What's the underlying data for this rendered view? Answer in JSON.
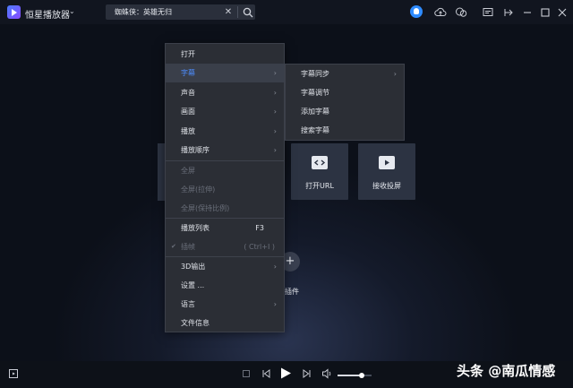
{
  "app": {
    "title": "恒星播放器",
    "title_chevron": "⌄"
  },
  "tab": {
    "label": "蜘蛛侠：英雄无归",
    "close": "✕"
  },
  "context_menu": {
    "items": [
      {
        "label": "打开",
        "state": "normal"
      },
      {
        "label": "字幕",
        "state": "active",
        "has_submenu": true
      },
      {
        "label": "声音",
        "state": "normal",
        "has_submenu": true
      },
      {
        "label": "画面",
        "state": "normal",
        "has_submenu": true
      },
      {
        "label": "播放",
        "state": "normal",
        "has_submenu": true
      },
      {
        "label": "播放顺序",
        "state": "normal",
        "has_submenu": true
      },
      {
        "label": "全屏",
        "state": "disabled"
      },
      {
        "label": "全屏(拉伸)",
        "state": "disabled"
      },
      {
        "label": "全屏(保持比例)",
        "state": "disabled"
      },
      {
        "label": "播放列表",
        "state": "normal",
        "shortcut": "F3"
      },
      {
        "label": "插帧",
        "state": "disabled",
        "shortcut": "( Ctrl+I )",
        "checked": true
      },
      {
        "label": "3D输出",
        "state": "normal",
        "has_submenu": true
      },
      {
        "label": "设置 ...",
        "state": "normal"
      },
      {
        "label": "语言",
        "state": "normal",
        "has_submenu": true
      },
      {
        "label": "文件信息",
        "state": "normal"
      }
    ],
    "arrow": "›",
    "check": "✔"
  },
  "submenu": {
    "items": [
      {
        "label": "字幕同步",
        "has_submenu": true
      },
      {
        "label": "字幕调节"
      },
      {
        "label": "添加字幕"
      },
      {
        "label": "搜索字幕"
      }
    ]
  },
  "tiles": [
    {
      "label": "打开URL",
      "icon": "link-icon"
    },
    {
      "label": "接收投屏",
      "icon": "cast-icon"
    }
  ],
  "plugin": {
    "label": "插件",
    "icon": "+"
  },
  "playback": {
    "volume": 0.7
  },
  "watermark": "头条 @南瓜情感",
  "colors": {
    "accent": "#4d8dff",
    "menu_bg": "#2b2e35",
    "avatar": "#2e8bff"
  }
}
